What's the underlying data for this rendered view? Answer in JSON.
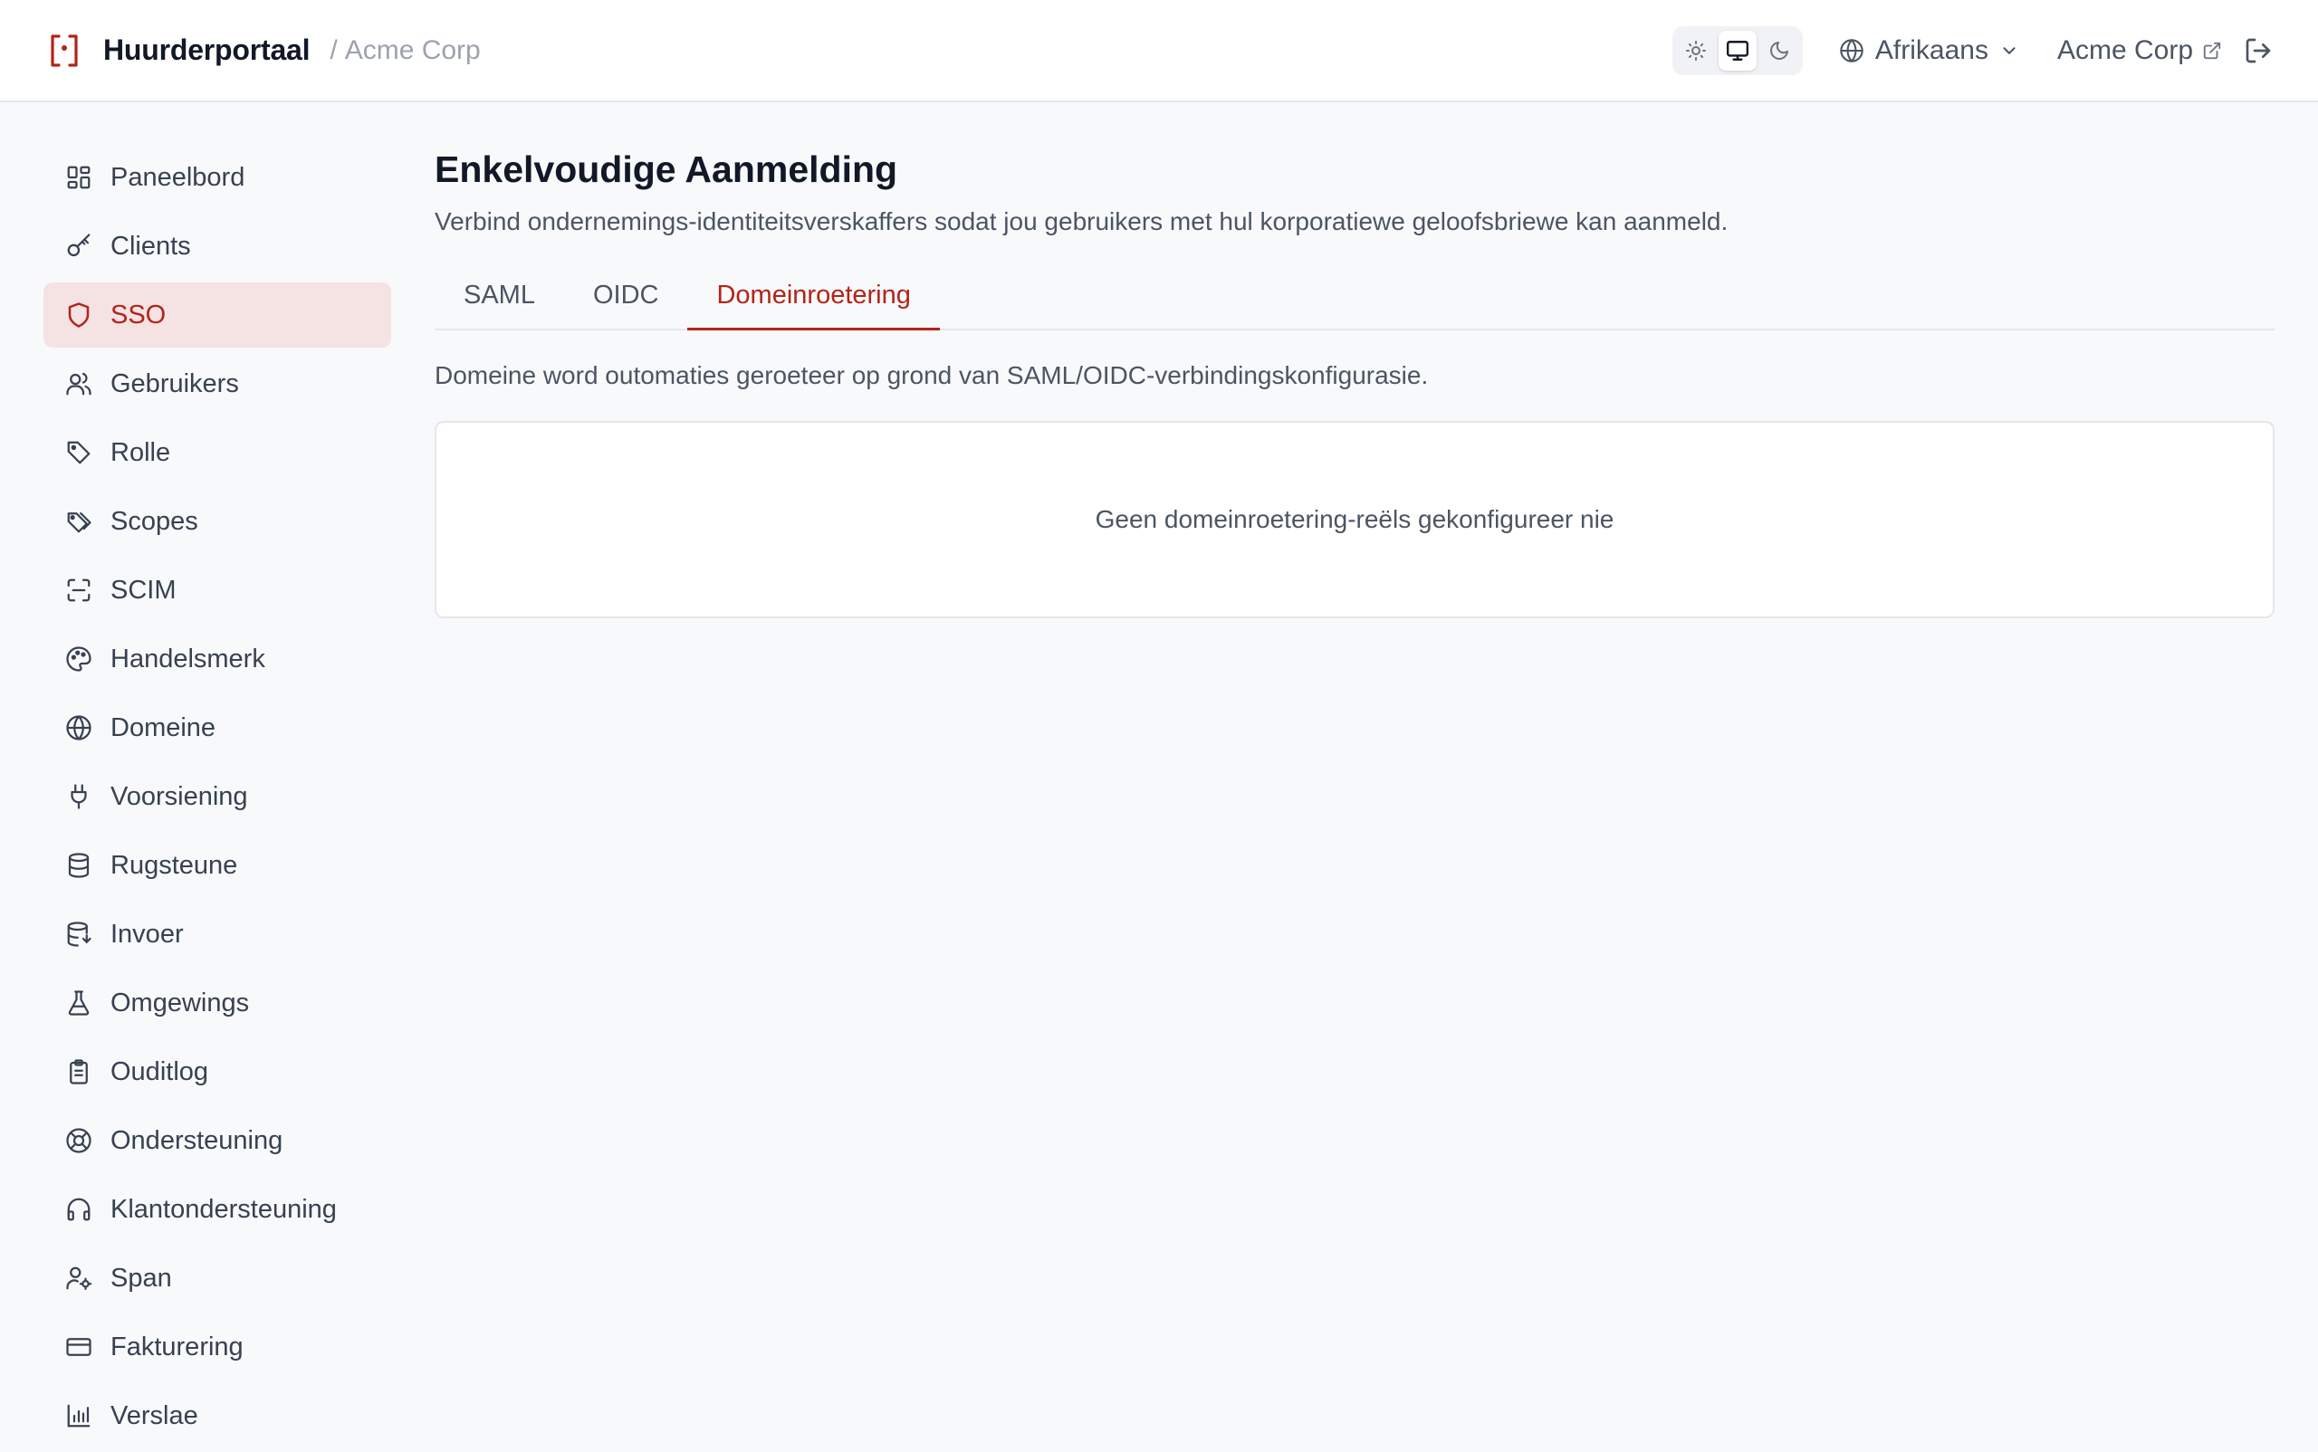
{
  "header": {
    "brand_title": "Huurderportaal",
    "separator": "/",
    "tenant_name": "Acme Corp",
    "language": "Afrikaans",
    "tenant_link": "Acme Corp",
    "theme_options": [
      "light",
      "system",
      "dark"
    ],
    "active_theme": "system"
  },
  "sidebar": {
    "items": [
      {
        "label": "Paneelbord",
        "icon": "dashboard-icon"
      },
      {
        "label": "Clients",
        "icon": "key-icon"
      },
      {
        "label": "SSO",
        "icon": "shield-icon",
        "active": true
      },
      {
        "label": "Gebruikers",
        "icon": "users-icon"
      },
      {
        "label": "Rolle",
        "icon": "tag-icon"
      },
      {
        "label": "Scopes",
        "icon": "tags-icon"
      },
      {
        "label": "SCIM",
        "icon": "scan-icon"
      },
      {
        "label": "Handelsmerk",
        "icon": "palette-icon"
      },
      {
        "label": "Domeine",
        "icon": "globe-icon"
      },
      {
        "label": "Voorsiening",
        "icon": "plug-icon"
      },
      {
        "label": "Rugsteune",
        "icon": "database-icon"
      },
      {
        "label": "Invoer",
        "icon": "database-import-icon"
      },
      {
        "label": "Omgewings",
        "icon": "flask-icon"
      },
      {
        "label": "Ouditlog",
        "icon": "clipboard-icon"
      },
      {
        "label": "Ondersteuning",
        "icon": "lifebuoy-icon"
      },
      {
        "label": "Klantondersteuning",
        "icon": "headphones-icon"
      },
      {
        "label": "Span",
        "icon": "user-cog-icon"
      },
      {
        "label": "Fakturering",
        "icon": "credit-card-icon"
      },
      {
        "label": "Verslae",
        "icon": "bar-chart-icon"
      }
    ]
  },
  "main": {
    "title": "Enkelvoudige Aanmelding",
    "subtitle": "Verbind ondernemings-identiteitsverskaffers sodat jou gebruikers met hul korporatiewe geloofsbriewe kan aanmeld.",
    "tabs": [
      {
        "label": "SAML"
      },
      {
        "label": "OIDC"
      },
      {
        "label": "Domeinroetering",
        "active": true
      }
    ],
    "info_text": "Domeine word outomaties geroeteer op grond van SAML/OIDC-verbindingskonfigurasie.",
    "empty_state": "Geen domeinroetering-reëls gekonfigureer nie"
  },
  "colors": {
    "accent": "#b42318",
    "active_nav_bg": "#f5e3e3"
  }
}
